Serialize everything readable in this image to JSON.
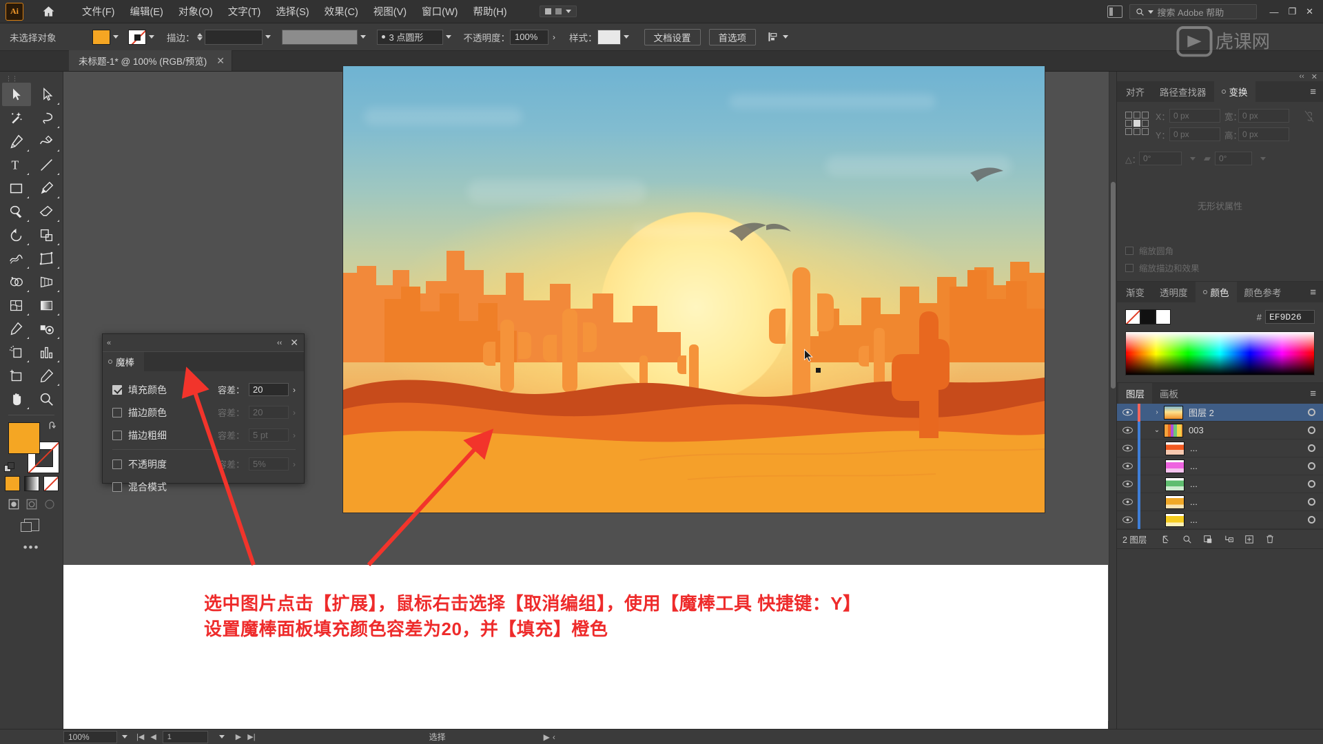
{
  "app": {
    "name": "Adobe Illustrator",
    "logo_text": "Ai"
  },
  "menubar": {
    "items": [
      {
        "label": "文件(F)"
      },
      {
        "label": "编辑(E)"
      },
      {
        "label": "对象(O)"
      },
      {
        "label": "文字(T)"
      },
      {
        "label": "选择(S)"
      },
      {
        "label": "效果(C)"
      },
      {
        "label": "视图(V)"
      },
      {
        "label": "窗口(W)"
      },
      {
        "label": "帮助(H)"
      }
    ],
    "search_placeholder": "搜索 Adobe 帮助",
    "window_buttons": [
      "—",
      "❐",
      "✕"
    ]
  },
  "control_bar": {
    "selection_status": "未选择对象",
    "stroke_label": "描边：",
    "stroke_weight": "",
    "brush_label": "3 点圆形",
    "opacity_label": "不透明度：",
    "opacity_value": "100%",
    "style_label": "样式：",
    "doc_setup_button": "文档设置",
    "preferences_button": "首选项"
  },
  "document_tab": {
    "title": "未标题-1* @ 100% (RGB/预览)",
    "close": "✕"
  },
  "toolbar": {
    "tools": [
      {
        "name": "selection-tool",
        "active": true
      },
      {
        "name": "direct-selection-tool",
        "active": false
      },
      {
        "name": "magic-wand-tool",
        "active": false
      },
      {
        "name": "lasso-tool",
        "active": false
      },
      {
        "name": "pen-tool",
        "active": false
      },
      {
        "name": "curvature-tool",
        "active": false
      },
      {
        "name": "type-tool",
        "active": false
      },
      {
        "name": "line-segment-tool",
        "active": false
      },
      {
        "name": "rectangle-tool",
        "active": false
      },
      {
        "name": "paintbrush-tool",
        "active": false
      },
      {
        "name": "shaper-tool",
        "active": false
      },
      {
        "name": "eraser-tool",
        "active": false
      },
      {
        "name": "rotate-tool",
        "active": false
      },
      {
        "name": "scale-tool",
        "active": false
      },
      {
        "name": "width-tool",
        "active": false
      },
      {
        "name": "free-transform-tool",
        "active": false
      },
      {
        "name": "shape-builder-tool",
        "active": false
      },
      {
        "name": "perspective-grid-tool",
        "active": false
      },
      {
        "name": "mesh-tool",
        "active": false
      },
      {
        "name": "gradient-tool",
        "active": false
      },
      {
        "name": "eyedropper-tool",
        "active": false
      },
      {
        "name": "blend-tool",
        "active": false
      },
      {
        "name": "symbol-sprayer-tool",
        "active": false
      },
      {
        "name": "column-graph-tool",
        "active": false
      },
      {
        "name": "artboard-tool",
        "active": false
      },
      {
        "name": "slice-tool",
        "active": false
      },
      {
        "name": "hand-tool",
        "active": false
      },
      {
        "name": "zoom-tool",
        "active": false
      }
    ],
    "fill_color": "#F5A623",
    "stroke_color": "#FFFFFF",
    "more_tools": "•••"
  },
  "magic_wand_panel": {
    "tab_label": "魔棒",
    "close": "✕",
    "rows": [
      {
        "label": "填充颜色",
        "checked": true,
        "tol_label": "容差：",
        "tol_value": "20",
        "enabled": true
      },
      {
        "label": "描边颜色",
        "checked": false,
        "tol_label": "容差：",
        "tol_value": "20",
        "enabled": false
      },
      {
        "label": "描边粗细",
        "checked": false,
        "tol_label": "容差：",
        "tol_value": "5 pt",
        "enabled": false
      },
      {
        "label": "不透明度",
        "checked": false,
        "tol_label": "容差：",
        "tol_value": "5%",
        "enabled": false
      },
      {
        "label": "混合模式",
        "checked": false,
        "tol_label": "",
        "tol_value": "",
        "enabled": false
      }
    ]
  },
  "transform_panel": {
    "tabs": [
      {
        "label": "对齐",
        "selected": false
      },
      {
        "label": "路径查找器",
        "selected": false
      },
      {
        "label": "变换",
        "selected": true
      }
    ],
    "fields": [
      {
        "label": "X：",
        "value": "0 px"
      },
      {
        "label": "宽：",
        "value": "0 px"
      },
      {
        "label": "Y：",
        "value": "0 px"
      },
      {
        "label": "高：",
        "value": "0 px"
      }
    ],
    "angle_label": "△：",
    "angle_value": "0°",
    "shear_value": "0°",
    "no_properties": "无形状属性",
    "check_scale_corners": "缩放圆角",
    "check_scale_strokes": "缩放描边和效果"
  },
  "color_panel": {
    "tabs": [
      {
        "label": "渐变",
        "selected": false
      },
      {
        "label": "透明度",
        "selected": false
      },
      {
        "label": "颜色",
        "selected": true
      },
      {
        "label": "颜色参考",
        "selected": false
      }
    ],
    "hash": "#",
    "hex_value": "EF9D26",
    "current_color": "#EF9D26"
  },
  "layers_panel": {
    "tabs": [
      {
        "label": "图层",
        "selected": true
      },
      {
        "label": "画板",
        "selected": false
      }
    ],
    "rows": [
      {
        "name": "图层 2",
        "selected": true,
        "indent": 0,
        "twirl": "›",
        "color": "#f2655c",
        "thumb": "artwork"
      },
      {
        "name": "003",
        "selected": false,
        "indent": 1,
        "twirl": "⌄",
        "color": "#3f7fd8",
        "thumb": "group"
      },
      {
        "name": "...",
        "selected": false,
        "indent": 2,
        "twirl": "",
        "color": "#3f7fd8",
        "thumb": "orange"
      },
      {
        "name": "...",
        "selected": false,
        "indent": 2,
        "twirl": "",
        "color": "#3f7fd8",
        "thumb": "magenta"
      },
      {
        "name": "...",
        "selected": false,
        "indent": 2,
        "twirl": "",
        "color": "#3f7fd8",
        "thumb": "green"
      },
      {
        "name": "...",
        "selected": false,
        "indent": 2,
        "twirl": "",
        "color": "#3f7fd8",
        "thumb": "amber"
      },
      {
        "name": "...",
        "selected": false,
        "indent": 2,
        "twirl": "",
        "color": "#3f7fd8",
        "thumb": "yellow"
      }
    ],
    "footer_count": "2 图层",
    "footer_icons": [
      "locate-object",
      "search-layer",
      "make-clipping-mask",
      "create-sublayer",
      "new-layer",
      "delete-layer"
    ]
  },
  "annotation": {
    "line1": "选中图片点击【扩展】，鼠标右击选择【取消编组】，使用【魔棒工具 快捷键：Y】",
    "line2": "设置魔棒面板填充颜色容差为20，并【填充】橙色",
    "color": "#EE2B2B"
  },
  "statusbar": {
    "zoom": "100%",
    "page": "1",
    "status_text": "选择"
  },
  "artwork": {
    "description": "desert-sunset-illustration",
    "sky_top": "#6FB3D2",
    "sky_bottom": "#EF8F30",
    "sun_color": "#FFEEA0",
    "sand_color": "#F5A02A",
    "mesa_color": "#F2762B",
    "dune_dark": "#C2451B"
  }
}
